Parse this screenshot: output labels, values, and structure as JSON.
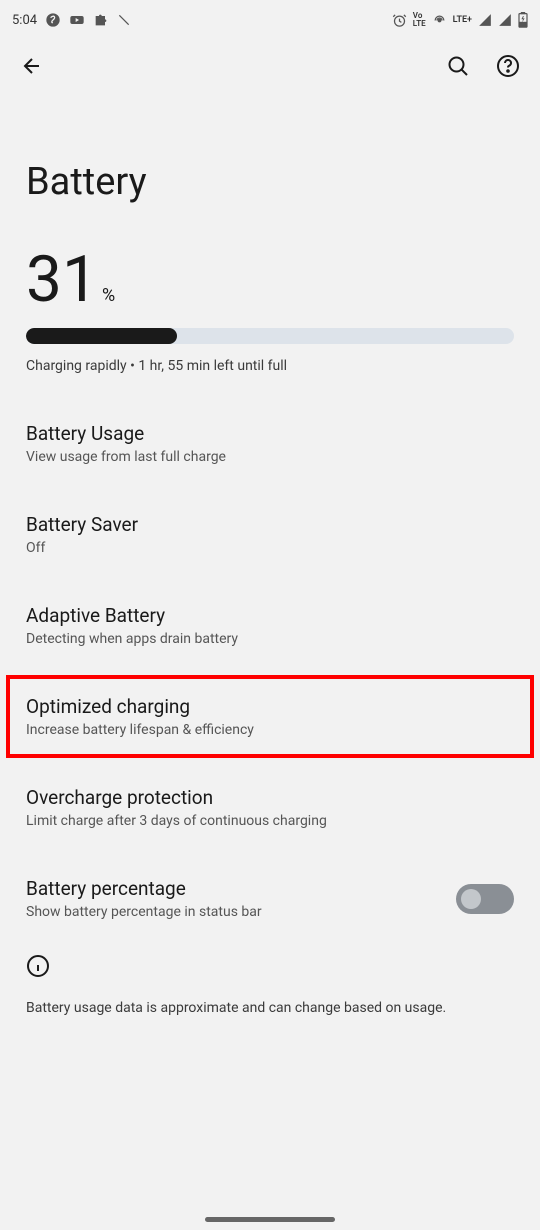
{
  "status_bar": {
    "time": "5:04",
    "lte_label": "LTE+",
    "volte_label": "Vo\nLTE"
  },
  "page": {
    "title": "Battery"
  },
  "battery": {
    "percent": "31",
    "percent_sign": "%",
    "progress": 31,
    "status": "Charging rapidly • 1 hr, 55 min left until full"
  },
  "settings": [
    {
      "title": "Battery Usage",
      "sub": "View usage from last full charge"
    },
    {
      "title": "Battery Saver",
      "sub": "Off"
    },
    {
      "title": "Adaptive Battery",
      "sub": "Detecting when apps drain battery"
    },
    {
      "title": "Optimized charging",
      "sub": "Increase battery lifespan & efficiency"
    },
    {
      "title": "Overcharge protection",
      "sub": "Limit charge after 3 days of continuous charging"
    },
    {
      "title": "Battery percentage",
      "sub": "Show battery percentage in status bar"
    }
  ],
  "info": {
    "text": "Battery usage data is approximate and can change based on usage."
  }
}
